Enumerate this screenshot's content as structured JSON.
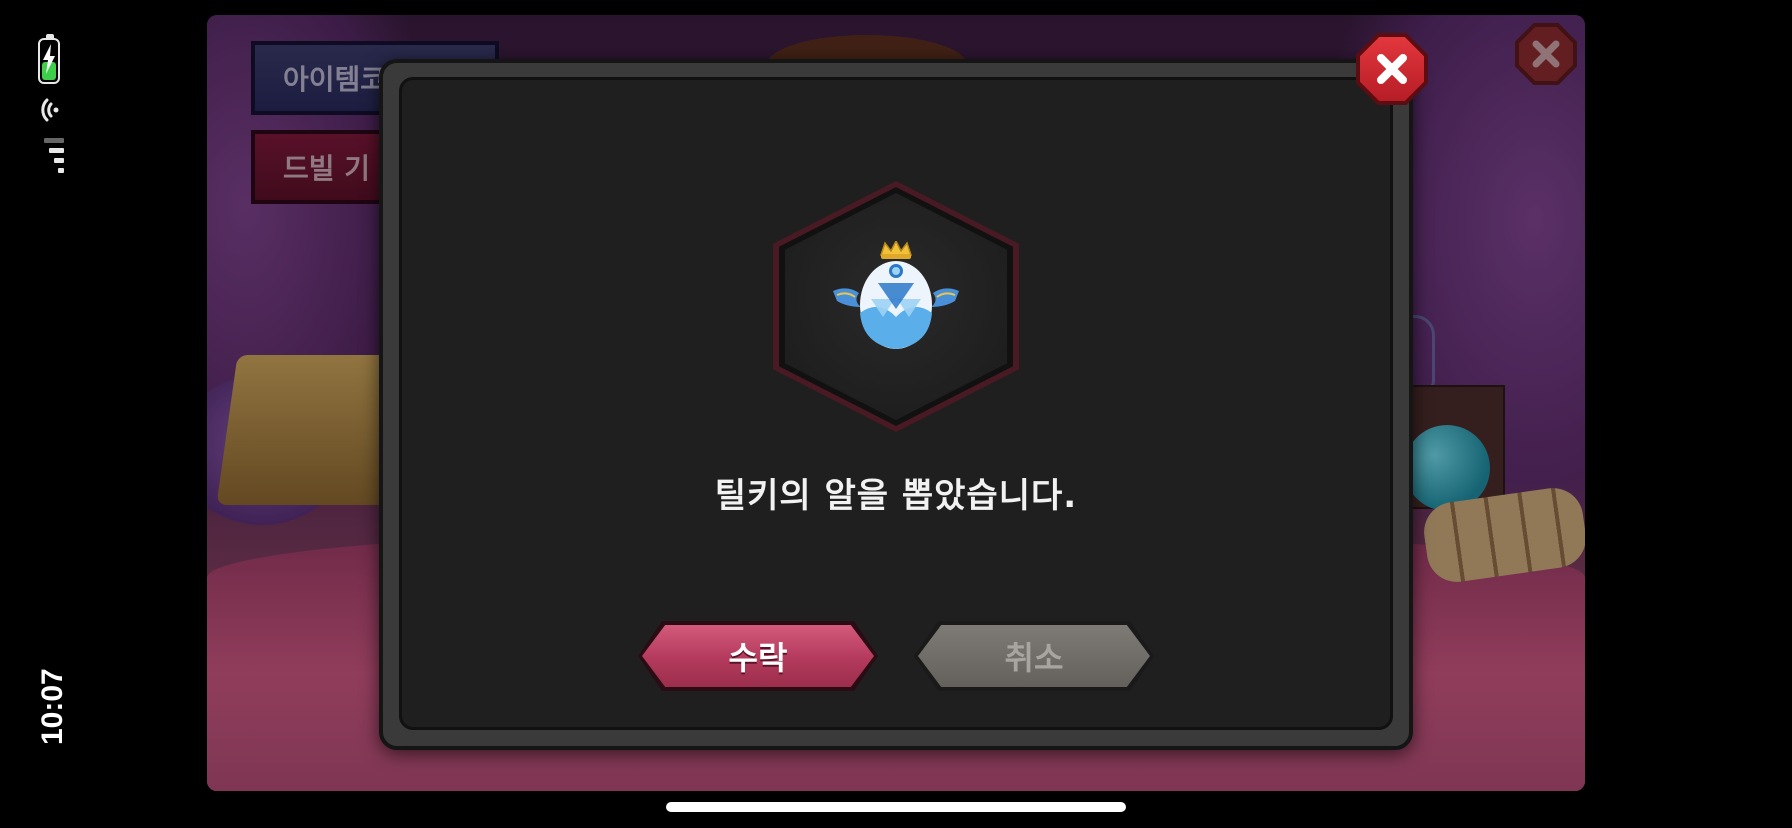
{
  "status_bar": {
    "time": "10:07",
    "battery_icon": "battery-charging-icon",
    "wifi_icon": "wifi-icon",
    "signal_icon": "cellular-signal-icon"
  },
  "background": {
    "buttons": [
      {
        "label": "아이템코"
      },
      {
        "label": "드빌 기"
      }
    ],
    "close_icon": "close-icon"
  },
  "dialog": {
    "item_icon": "crowned-winged-egg-icon",
    "message": "틸키의 알을 뽑았습니다.",
    "accept_label": "수락",
    "cancel_label": "취소",
    "close_icon": "close-icon"
  },
  "colors": {
    "accept": "#c2456a",
    "cancel": "#726e6a",
    "close": "#d12a33",
    "dialog_bg": "#1f1f1f"
  }
}
